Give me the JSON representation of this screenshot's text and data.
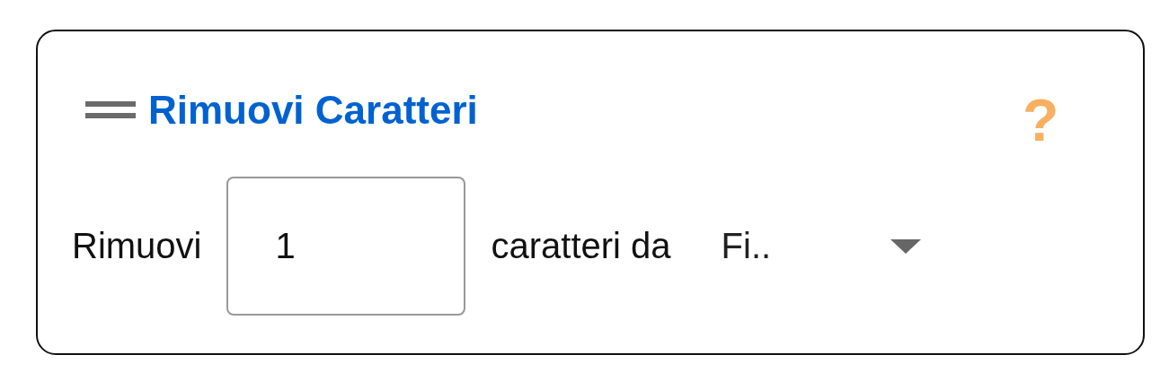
{
  "block": {
    "title": "Rimuovi Caratteri",
    "help": "?"
  },
  "row": {
    "label_before": "Rimuovi",
    "count": "1",
    "label_after": "caratteri da",
    "dropdown": "Fi.."
  }
}
